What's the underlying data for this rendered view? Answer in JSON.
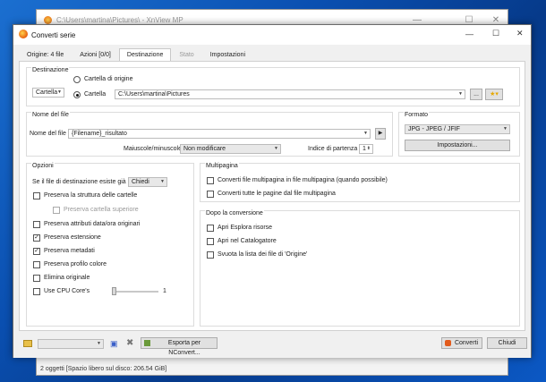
{
  "bg_window": {
    "title": "C:\\Users\\martina\\Pictures\\ - XnView MP",
    "status": "2 oggetti [Spazio libero sul disco: 206.54 GiB]"
  },
  "dialog": {
    "title": "Converti serie",
    "tabs": [
      "Origine: 4 file",
      "Azioni [0/0]",
      "Destinazione",
      "Stato",
      "Impostazioni"
    ],
    "destinazione": {
      "caption": "Destinazione",
      "mode_combo": "Cartella",
      "radio_origine": "Cartella di origine",
      "radio_cartella": "Cartella",
      "path": "C:\\Users\\martina\\Pictures",
      "browse": "..."
    },
    "nome_file": {
      "caption": "Nome del file",
      "label": "Nome del file",
      "value": "{Filename}_risultato",
      "case_label": "Maiuscole/minuscole",
      "case_value": "Non modificare",
      "index_label": "Indice di partenza",
      "index_value": "1"
    },
    "formato": {
      "caption": "Formato",
      "value": "JPG - JPEG / JFIF",
      "settings": "Impostazioni..."
    },
    "opzioni": {
      "caption": "Opzioni",
      "exists_label": "Se il file di destinazione esiste già",
      "exists_value": "Chiedi",
      "items": [
        {
          "label": "Preserva la struttura delle cartelle",
          "checked": false
        },
        {
          "label": "Preserva cartella superiore",
          "checked": false,
          "disabled": true
        },
        {
          "label": "Preserva attributi data/ora originari",
          "checked": false
        },
        {
          "label": "Preserva estensione",
          "checked": true
        },
        {
          "label": "Preserva metadati",
          "checked": true
        },
        {
          "label": "Preserva profilo colore",
          "checked": false
        },
        {
          "label": "Elimina originale",
          "checked": false
        },
        {
          "label": "Use CPU Core's",
          "checked": false
        }
      ],
      "cpu_value": "1"
    },
    "multipagina": {
      "caption": "Multipagina",
      "items": [
        "Converti file multipagina in file multipagina (quando possibile)",
        "Converti tutte le pagine dal file multipagina"
      ]
    },
    "dopo": {
      "caption": "Dopo la conversione",
      "items": [
        "Apri Esplora risorse",
        "Apri nel Catalogatore",
        "Svuota la lista dei file di 'Origine'"
      ]
    },
    "footer": {
      "export": "Esporta per NConvert...",
      "convert": "Converti",
      "close": "Chiudi"
    }
  }
}
